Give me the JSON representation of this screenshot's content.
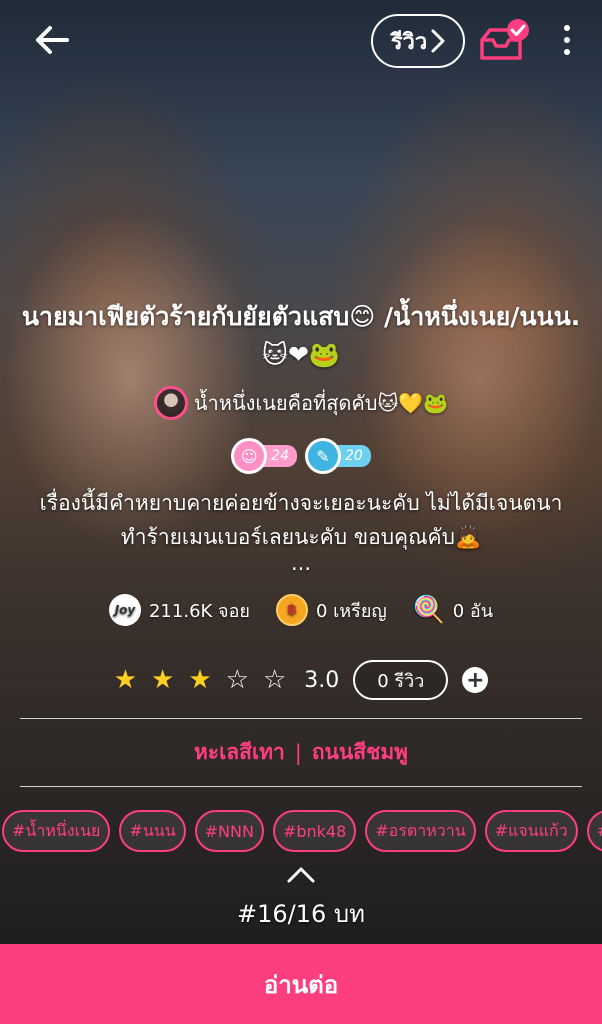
{
  "header": {
    "review_label": "รีวิว",
    "icons": [
      "back-arrow-icon",
      "chevron-right-icon",
      "bookshelf-check-icon",
      "more-vert-icon"
    ]
  },
  "story": {
    "title": "นายมาเฟียตัวร้ายกับยัยตัวแสบ😊 /น้ำหนึ่งเนย/นนน.🐱❤🐸",
    "author": "น้ำหนึ่งเนยคือที่สุดคับ🐱💛🐸",
    "badges": [
      {
        "icon": "face-icon",
        "value": "24"
      },
      {
        "icon": "pencil-icon",
        "value": "20"
      }
    ],
    "description_line1": "เรื่องนี้มีคำหยาบคายค่อยข้างจะเยอะนะคับ ไม่ได้มีเจนตนา",
    "description_line2": "ทำร้ายเมนเบอร์เลยนะคับ ขอบคุณคับ🙇",
    "description_more": "...",
    "stats": {
      "joy_icon_label": "Joy",
      "joy": "211.6K จอย",
      "coins": "0 เหรียญ",
      "candy": "0 อัน"
    },
    "rating": {
      "stars_filled": 3,
      "stars_total": 5,
      "score": "3.0",
      "review_count": "0 รีวิว"
    },
    "genre": {
      "primary": "หะเลสีเทา",
      "secondary": "ถนนสีชมพู"
    },
    "tags": [
      "#น้ำหนึ่งเนย",
      "#นนน",
      "#NNN",
      "#bnk48",
      "#อรตาหวาน",
      "#แจนแก้ว",
      "#เฌ"
    ],
    "chapters": "#16/16 บท"
  },
  "footer": {
    "read_button": "อ่านต่อ"
  },
  "colors": {
    "accent": "#fd3e7e",
    "star": "#ffcf1f",
    "tag_border": "#ff3d7f"
  }
}
